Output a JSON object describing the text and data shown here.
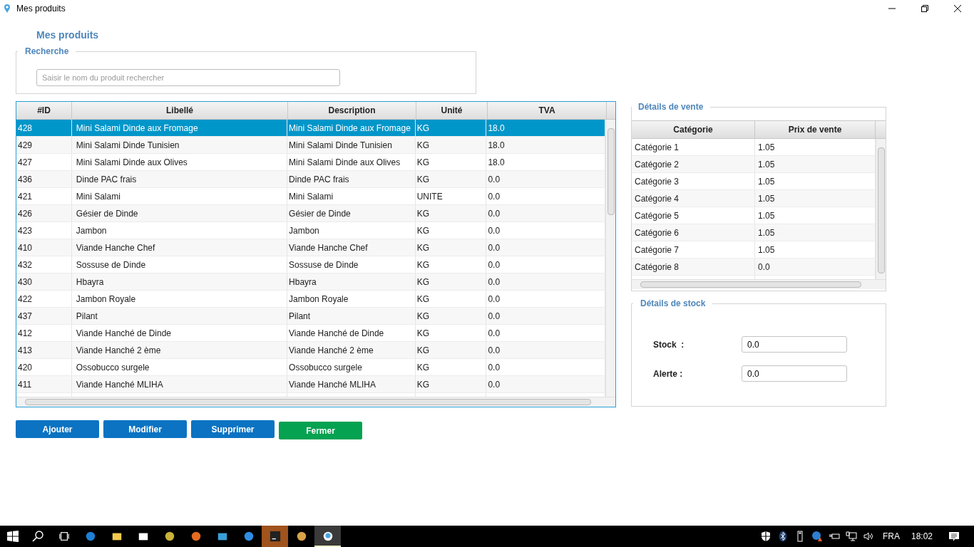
{
  "window": {
    "title": "Mes produits"
  },
  "heading": "Mes produits",
  "search": {
    "legend": "Recherche",
    "placeholder": "Saisir le nom du produit rechercher"
  },
  "products": {
    "columns": [
      "#ID",
      "Libellé",
      "Description",
      "Unité",
      "TVA"
    ],
    "rows": [
      {
        "cells": [
          "428",
          "Mini Salami Dinde aux Fromage",
          "Mini Salami Dinde aux Fromage",
          "KG",
          "18.0"
        ],
        "selected": true
      },
      {
        "cells": [
          "429",
          "Mini Salami Dinde Tunisien",
          "Mini Salami Dinde Tunisien",
          "KG",
          "18.0"
        ],
        "selected": false
      },
      {
        "cells": [
          "427",
          "Mini Salami Dinde aux Olives",
          "Mini Salami Dinde aux Olives",
          "KG",
          "18.0"
        ],
        "selected": false
      },
      {
        "cells": [
          "436",
          "Dinde PAC frais",
          "Dinde PAC frais",
          "KG",
          "0.0"
        ],
        "selected": false
      },
      {
        "cells": [
          "421",
          "Mini Salami",
          "Mini Salami",
          "UNITE",
          "0.0"
        ],
        "selected": false
      },
      {
        "cells": [
          "426",
          "Gésier de Dinde",
          "Gésier de Dinde",
          "KG",
          "0.0"
        ],
        "selected": false
      },
      {
        "cells": [
          "423",
          "Jambon",
          "Jambon",
          "KG",
          "0.0"
        ],
        "selected": false
      },
      {
        "cells": [
          "410",
          "Viande Hanche Chef",
          "Viande Hanche Chef",
          "KG",
          "0.0"
        ],
        "selected": false
      },
      {
        "cells": [
          "432",
          "Sossuse de Dinde",
          "Sossuse de Dinde",
          "KG",
          "0.0"
        ],
        "selected": false
      },
      {
        "cells": [
          "430",
          "Hbayra",
          "Hbayra",
          "KG",
          "0.0"
        ],
        "selected": false
      },
      {
        "cells": [
          "422",
          "Jambon Royale",
          "Jambon Royale",
          "KG",
          "0.0"
        ],
        "selected": false
      },
      {
        "cells": [
          "437",
          "Pilant",
          "Pilant",
          "KG",
          "0.0"
        ],
        "selected": false
      },
      {
        "cells": [
          "412",
          "Viande Hanché de Dinde",
          "Viande Hanché de Dinde",
          "KG",
          "0.0"
        ],
        "selected": false
      },
      {
        "cells": [
          "413",
          "Viande Hanché 2 ème",
          "Viande Hanché 2 ème",
          "KG",
          "0.0"
        ],
        "selected": false
      },
      {
        "cells": [
          "420",
          "Ossobucco surgele",
          "Ossobucco surgele",
          "KG",
          "0.0"
        ],
        "selected": false
      },
      {
        "cells": [
          "411",
          "Viande Hanché MLIHA",
          "Viande Hanché MLIHA",
          "KG",
          "0.0"
        ],
        "selected": false
      }
    ]
  },
  "sale_details": {
    "legend": "Détails de vente",
    "columns": [
      "Catégorie",
      "Prix de vente"
    ],
    "rows": [
      [
        "Catégorie 1",
        "1.05"
      ],
      [
        "Catégorie 2",
        "1.05"
      ],
      [
        "Catégorie 3",
        "1.05"
      ],
      [
        "Catégorie 4",
        "1.05"
      ],
      [
        "Catégorie 5",
        "1.05"
      ],
      [
        "Catégorie 6",
        "1.05"
      ],
      [
        "Catégorie 7",
        "1.05"
      ],
      [
        "Catégorie 8",
        "0.0"
      ]
    ]
  },
  "stock_details": {
    "legend": "Détails de stock",
    "fields": [
      {
        "label": "Stock  :",
        "value": "0.0"
      },
      {
        "label": "Alerte :",
        "value": "0.0"
      }
    ]
  },
  "buttons": [
    {
      "label": "Ajouter",
      "kind": "primary"
    },
    {
      "label": "Modifier",
      "kind": "primary"
    },
    {
      "label": "Supprimer",
      "kind": "primary"
    },
    {
      "label": "Fermer",
      "kind": "success"
    }
  ],
  "taskbar": {
    "apps": [
      {
        "kind": "edge",
        "selected": false,
        "attention": false
      },
      {
        "kind": "folder",
        "selected": false,
        "attention": false
      },
      {
        "kind": "store",
        "selected": false,
        "attention": false
      },
      {
        "kind": "network",
        "selected": false,
        "attention": false
      },
      {
        "kind": "firefox",
        "selected": false,
        "attention": false
      },
      {
        "kind": "brackets",
        "selected": false,
        "attention": false
      },
      {
        "kind": "ie",
        "selected": false,
        "attention": false
      },
      {
        "kind": "ide",
        "selected": false,
        "attention": true
      },
      {
        "kind": "paint",
        "selected": false,
        "attention": false
      },
      {
        "kind": "pin",
        "selected": true,
        "attention": false
      }
    ],
    "language": "FRA",
    "time": "18:02"
  }
}
